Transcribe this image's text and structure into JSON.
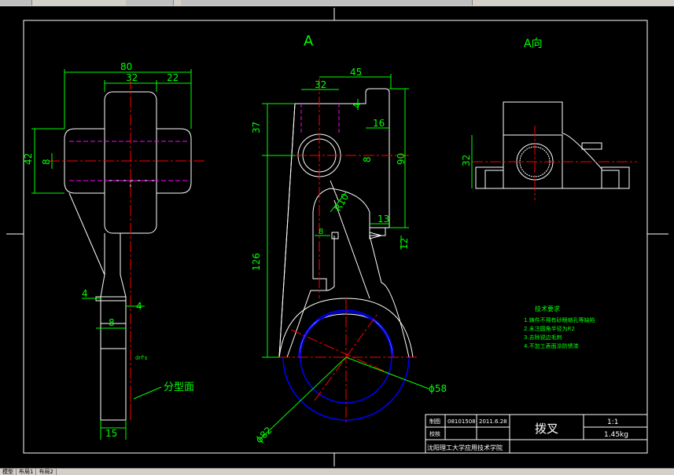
{
  "window": {
    "title": "",
    "view": "A"
  },
  "view_label_top": "A",
  "view_label_right": "A向",
  "dims": {
    "d80": "80",
    "d32a": "32",
    "d22": "22",
    "d42": "42",
    "d8a": "8",
    "d4a": "4",
    "d4b": "4",
    "d8b": "8",
    "d15": "15",
    "d45": "45",
    "d32b": "32",
    "d37": "37",
    "d4c": "4",
    "d16": "16",
    "d90": "90",
    "d8c": "8",
    "r10": "R10",
    "d13": "13",
    "d12": "12",
    "d8d": "8",
    "d126": "126",
    "phi58": "ϕ58",
    "phi82": "ϕ82",
    "d32c": "32"
  },
  "annotations": {
    "parting_face": "分型面",
    "small_note": "drf's"
  },
  "tech_req": {
    "title": "技术要求",
    "items": [
      "1.铸件不得有砂眼缩孔等缺陷",
      "2.未注圆角半径为R2",
      "3.去除锐边毛刺",
      "4.不加工表面涂防锈漆"
    ]
  },
  "title_block": {
    "drawn_label": "制图",
    "drawn_id": "08101508",
    "date": "2011.6.28",
    "check_label": "校核",
    "part_name": "拨叉",
    "scale": "1:1",
    "weight": "1.45kg",
    "school": "沈阳理工大学应用技术学院"
  },
  "tabs": [
    "模型",
    "布局1",
    "布局2"
  ],
  "colors": {
    "background": "#000000",
    "line": "#ffffff",
    "dim": "#00ff00",
    "center": "#ff0000",
    "hidden": "#ff00ff",
    "circle": "#0000ff",
    "note": "#00ff00"
  }
}
